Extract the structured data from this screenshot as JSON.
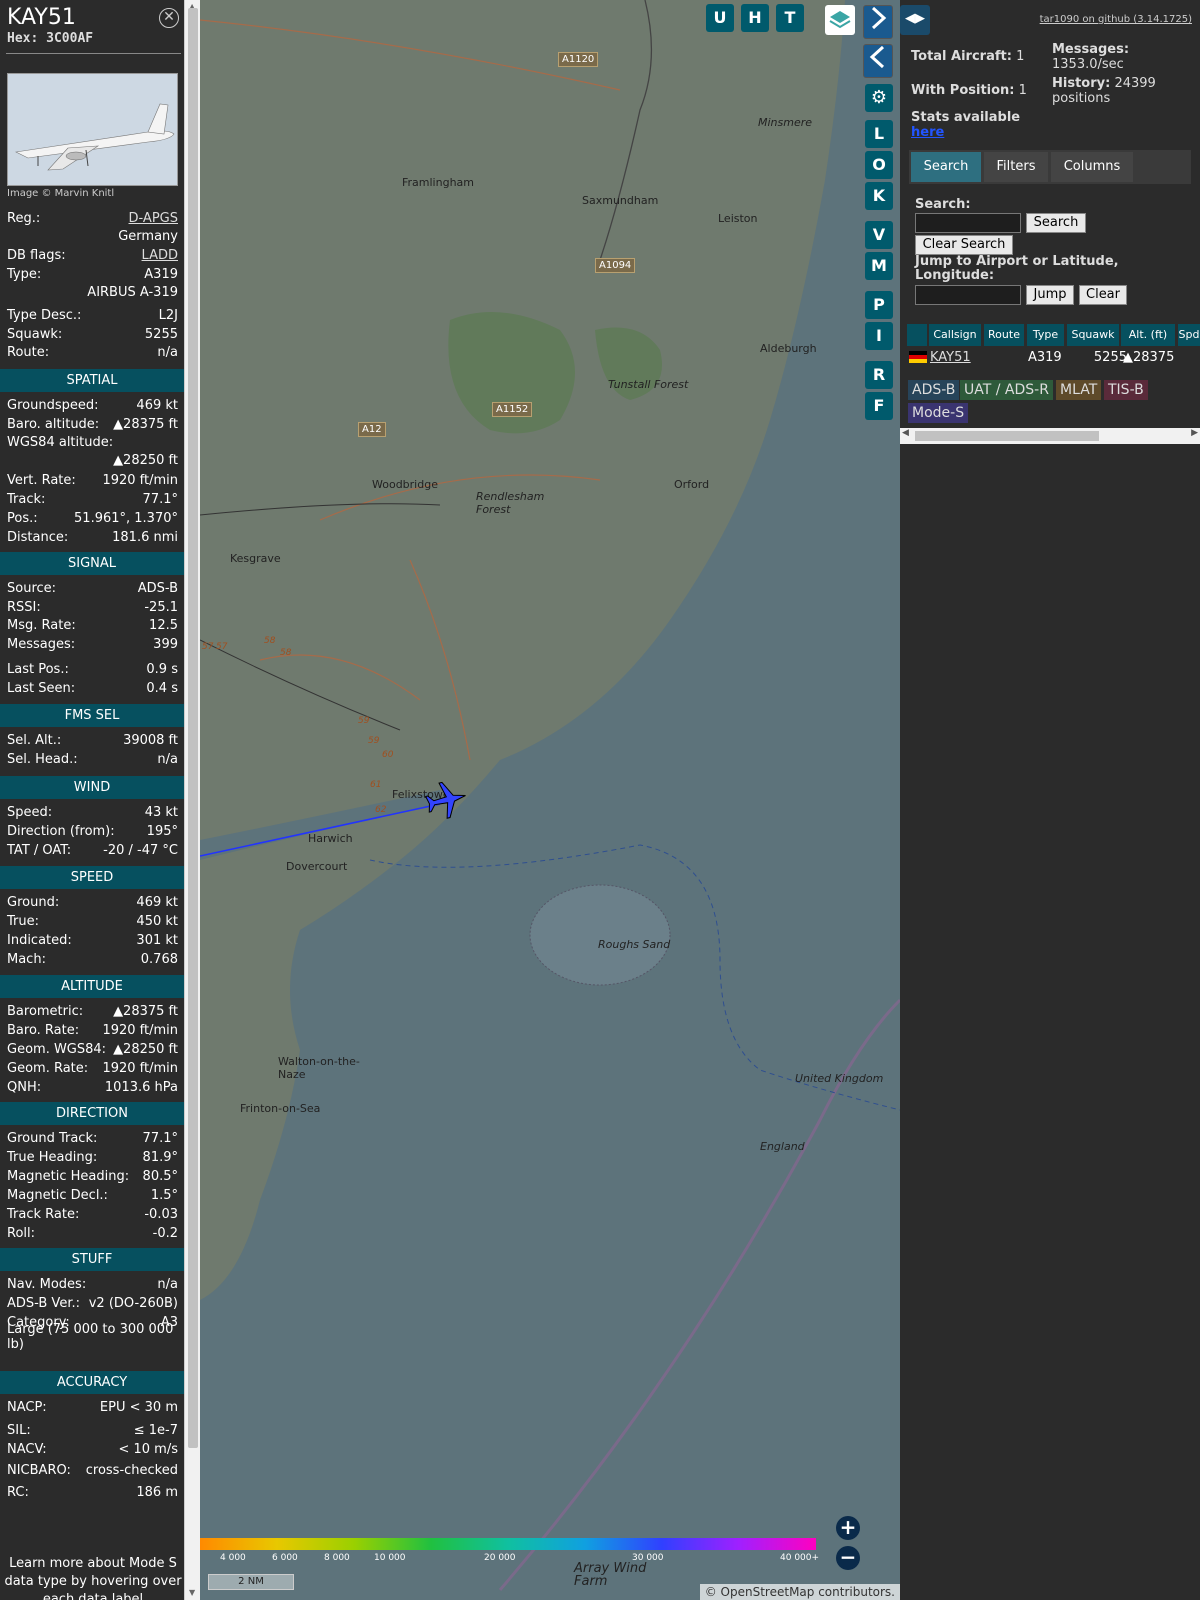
{
  "detail": {
    "callsign": "KAY51",
    "hex": "Hex: 3C00AF",
    "close_icon": "close-icon",
    "photo_credit": "Image © Marvin Knitl",
    "reg_label": "Reg.:",
    "reg_value": "D-APGS",
    "country": "Germany",
    "dbflags_label": "DB flags:",
    "dbflags_value": "LADD",
    "type_label": "Type:",
    "type_value": "A319",
    "type_full": "AIRBUS A-319",
    "typedesc_label": "Type Desc.:",
    "typedesc_value": "L2J",
    "squawk_label": "Squawk:",
    "squawk_value": "5255",
    "route_label": "Route:",
    "route_value": "n/a"
  },
  "spatial": {
    "title": "SPATIAL",
    "rows": [
      {
        "l": "Groundspeed:",
        "v": "469 kt"
      },
      {
        "l": "Baro. altitude:",
        "v": "▲28375 ft"
      },
      {
        "l": "WGS84 altitude:",
        "v": ""
      },
      {
        "l": "",
        "v": "▲28250 ft"
      },
      {
        "l": "Vert. Rate:",
        "v": "1920 ft/min"
      },
      {
        "l": "Track:",
        "v": "77.1°"
      },
      {
        "l": "Pos.:",
        "v": "51.961°, 1.370°"
      },
      {
        "l": "Distance:",
        "v": "181.6 nmi"
      }
    ]
  },
  "signal": {
    "title": "SIGNAL",
    "rows": [
      {
        "l": "Source:",
        "v": "ADS-B"
      },
      {
        "l": "RSSI:",
        "v": "-25.1"
      },
      {
        "l": "Msg. Rate:",
        "v": "12.5"
      },
      {
        "l": "Messages:",
        "v": "399"
      },
      {
        "l": "Last Pos.:",
        "v": "0.9 s"
      },
      {
        "l": "Last Seen:",
        "v": "0.4 s"
      }
    ]
  },
  "fms": {
    "title": "FMS SEL",
    "rows": [
      {
        "l": "Sel. Alt.:",
        "v": "39008 ft"
      },
      {
        "l": "Sel. Head.:",
        "v": "n/a"
      }
    ]
  },
  "wind": {
    "title": "WIND",
    "rows": [
      {
        "l": "Speed:",
        "v": "43 kt"
      },
      {
        "l": "Direction (from):",
        "v": "195°"
      },
      {
        "l": "TAT / OAT:",
        "v": "-20 / -47 °C"
      }
    ]
  },
  "speed": {
    "title": "SPEED",
    "rows": [
      {
        "l": "Ground:",
        "v": "469 kt"
      },
      {
        "l": "True:",
        "v": "450 kt"
      },
      {
        "l": "Indicated:",
        "v": "301 kt"
      },
      {
        "l": "Mach:",
        "v": "0.768"
      }
    ]
  },
  "altitude": {
    "title": "ALTITUDE",
    "rows": [
      {
        "l": "Barometric:",
        "v": "▲28375 ft"
      },
      {
        "l": "Baro. Rate:",
        "v": "1920 ft/min"
      },
      {
        "l": "Geom. WGS84:",
        "v": "▲28250 ft"
      },
      {
        "l": "Geom. Rate:",
        "v": "1920 ft/min"
      },
      {
        "l": "QNH:",
        "v": "1013.6 hPa"
      }
    ]
  },
  "direction": {
    "title": "DIRECTION",
    "rows": [
      {
        "l": "Ground Track:",
        "v": "77.1°"
      },
      {
        "l": "True Heading:",
        "v": "81.9°"
      },
      {
        "l": "Magnetic Heading:",
        "v": "80.5°"
      },
      {
        "l": "Magnetic Decl.:",
        "v": "1.5°"
      },
      {
        "l": "Track Rate:",
        "v": "-0.03"
      },
      {
        "l": "Roll:",
        "v": "-0.2"
      }
    ]
  },
  "stuff": {
    "title": "STUFF",
    "rows": [
      {
        "l": "Nav. Modes:",
        "v": "n/a"
      },
      {
        "l": "ADS-B Ver.:",
        "v": "v2 (DO-260B)"
      },
      {
        "l": "Category:",
        "v": "A3"
      }
    ],
    "category_desc": "Large (75 000 to 300 000 lb)"
  },
  "accuracy": {
    "title": "ACCURACY",
    "rows": [
      {
        "l": "NACP:",
        "v": "EPU < 30 m"
      },
      {
        "l": "SIL:",
        "v": "≤ 1e-7"
      },
      {
        "l": "NACV:",
        "v": "< 10 m/s"
      },
      {
        "l": "NICBARO:",
        "v": "cross-checked"
      },
      {
        "l": "RC:",
        "v": "186 m"
      }
    ],
    "footer": "Learn more about Mode S data type by hovering over each data label"
  },
  "map": {
    "places": [
      "Framlingham",
      "Saxmundham",
      "Leiston",
      "Minsmere",
      "Tunstall Forest",
      "Aldeburgh",
      "Woodbridge",
      "Rendlesham Forest",
      "Orford",
      "Kesgrave",
      "Felixstowe",
      "Harwich",
      "Dovercourt",
      "Walton-on-the-Naze",
      "Frinton-on-Sea",
      "Roughs Sand",
      "Array Wind Farm",
      "United Kingdom",
      "England"
    ],
    "roads": [
      "A1120",
      "A1094",
      "A12",
      "A1152"
    ],
    "waypoints": [
      "57",
      "57",
      "58",
      "58",
      "59",
      "59",
      "60",
      "61",
      "62"
    ],
    "scale": "2 NM",
    "attribution": "© OpenStreetMap contributors.",
    "alt_ticks": [
      "4 000",
      "6 000",
      "8 000",
      "10 000",
      "20 000",
      "30 000",
      "40 000+"
    ],
    "buttons": [
      "U",
      "H",
      "T",
      "L",
      "O",
      "K",
      "V",
      "M",
      "P",
      "I",
      "R",
      "F"
    ],
    "zoom_in": "+",
    "zoom_out": "−"
  },
  "stats": {
    "github": "tar1090 on github (3.14.1725)",
    "total_label": "Total Aircraft:",
    "total_value": "1",
    "withpos_label": "With Position:",
    "withpos_value": "1",
    "messages_label": "Messages:",
    "messages_value": "1353.0/sec",
    "history_label": "History:",
    "history_value": "24399 positions",
    "stats_label": "Stats available",
    "stats_link": "here"
  },
  "tabs": [
    "Search",
    "Filters",
    "Columns"
  ],
  "search": {
    "label": "Search:",
    "button": "Search",
    "clear": "Clear Search",
    "jump_label": "Jump to Airport or Latitude, Longitude:",
    "jump": "Jump",
    "jump_clear": "Clear"
  },
  "table": {
    "headers": [
      "Callsign",
      "Route",
      "Type",
      "Squawk",
      "Alt. (ft)",
      "Spd"
    ],
    "row": {
      "callsign": "KAY51",
      "route": "",
      "type": "A319",
      "squawk": "5255",
      "alt": "▲28375"
    }
  },
  "legend": [
    {
      "label": "ADS-B",
      "color": "#27445a"
    },
    {
      "label": "UAT / ADS-R",
      "color": "#2e5a3a"
    },
    {
      "label": "MLAT",
      "color": "#5e4a2a"
    },
    {
      "label": "TIS-B",
      "color": "#5a2a3a"
    },
    {
      "label": "Mode-S",
      "color": "#3a3470"
    }
  ]
}
